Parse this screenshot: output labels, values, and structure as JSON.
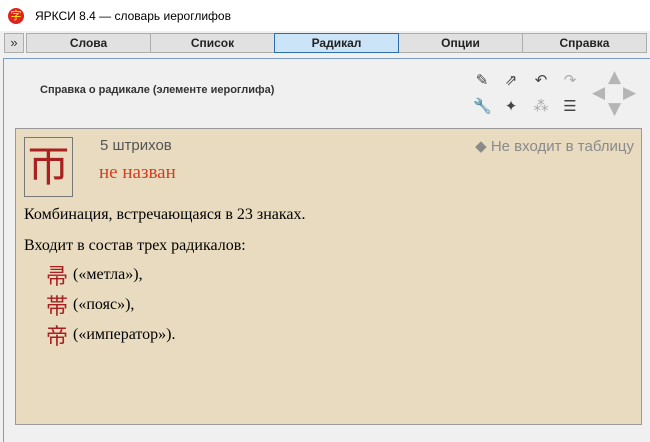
{
  "window": {
    "title": "ЯРКСИ 8.4 — словарь иероглифов",
    "app_icon": "字"
  },
  "tabs": [
    {
      "label": "Слова"
    },
    {
      "label": "Список"
    },
    {
      "label": "Радикал"
    },
    {
      "label": "Опции"
    },
    {
      "label": "Справка"
    }
  ],
  "expand_label": "»",
  "heading": "Справка о радикале  (элементе иероглифа)",
  "radical": {
    "glyph": "帀",
    "strokes": "5  штрихов",
    "name": "не назван",
    "table_status": "◆ Не входит в таблицу",
    "combination": "Комбинация, встречающаяся в 23 знаках.",
    "included_in": "Входит в состав трех радикалов:",
    "radicals": [
      {
        "glyph": "帚",
        "meaning": "(«метла»),"
      },
      {
        "glyph": "帯",
        "meaning": "(«пояс»),"
      },
      {
        "glyph": "帝",
        "meaning": "(«император»)."
      }
    ]
  }
}
